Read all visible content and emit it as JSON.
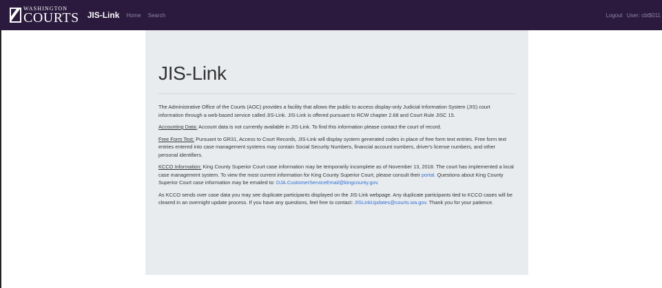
{
  "navbar": {
    "logo_top": "WASHINGTON",
    "logo_bottom": "COURTS",
    "brand": "JIS-Link",
    "links": [
      "Home",
      "Search"
    ],
    "logout": "Logout",
    "user": "User: cbt$011"
  },
  "main": {
    "title": "JIS-Link",
    "intro": "The Administrative Office of the Courts (AOC) provides a facility that allows the public to access display-only Judicial Information System (JIS) court information through a web-based service called JIS-Link. JIS-Link is offered pursuant to RCW chapter 2.68 and Court Rule JISC 15.",
    "accounting_label": "Accounting Data:",
    "accounting_text": " Account data is not currently available in JIS-Link. To find this information please contact the court of record.",
    "freeform_label": "Free Form Text:",
    "freeform_text": " Pursuant to GR31, Access to Court Records, JIS-Link will display system generated codes in place of free form text entries. Free form text entries entered into case management systems may contain Social Security Numbers, financial account numbers, driver's license numbers, and other personal identifiers.",
    "kcco_label": "KCCO Information:",
    "kcco_text_1": " King County Superior Court case information may be temporarily incomplete as of November 13, 2018. The court has implemented a local case management system. To view the most current information for King County Superior Court, please consult their ",
    "kcco_portal": "portal.",
    "kcco_text_2": " Questions about King County Superior Court case information may be emailed to: ",
    "kcco_email": "DJA.CustomerServiceEmail@kingcounty.gov.",
    "dup_text_1": "As KCCO sends over case data you may see duplicate participants displayed on the JIS-Link webpage. Any duplicate participants tied to KCCO cases will be cleared in an overnight update process. If you have any questions, feel free to contact: ",
    "dup_email": "JISLinkUpdates@courts.wa.gov",
    "dup_text_2": ". Thank you for your patience."
  },
  "colors": {
    "navbar_bg": "#2b1a3d",
    "panel_bg": "#e9ecef",
    "link": "#2f6fd0"
  }
}
